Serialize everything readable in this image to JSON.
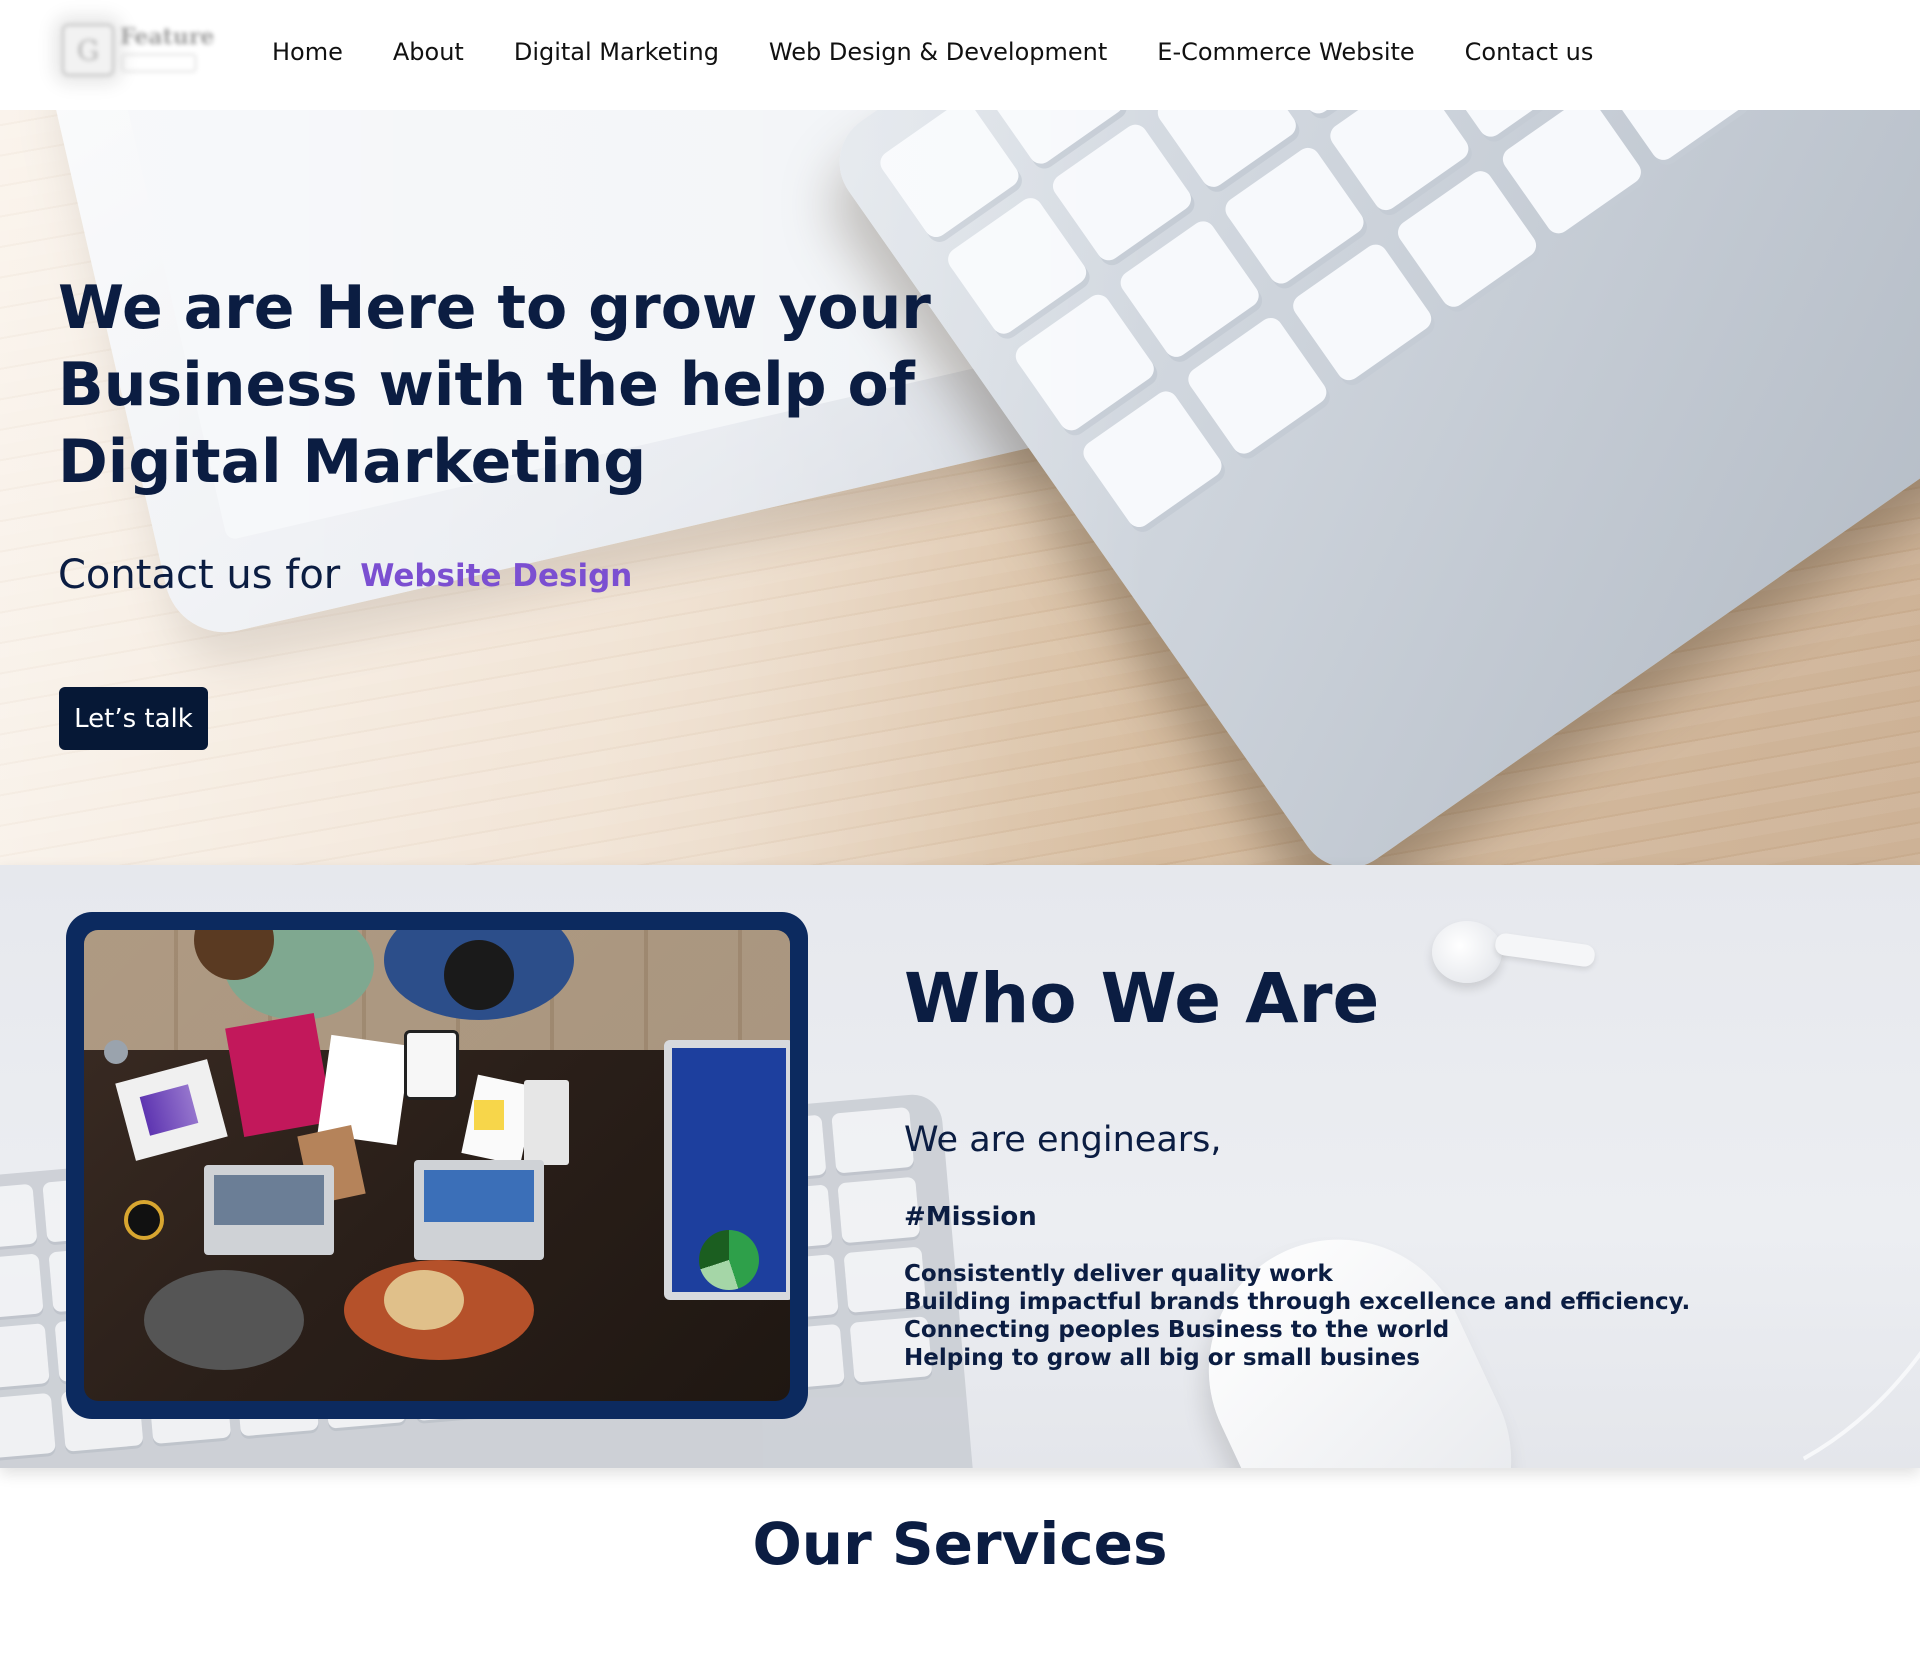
{
  "brand": {
    "logo_text": "Feature"
  },
  "nav": {
    "items": [
      {
        "label": "Home"
      },
      {
        "label": "About"
      },
      {
        "label": "Digital Marketing"
      },
      {
        "label": "Web Design & Development"
      },
      {
        "label": "E-Commerce Website"
      },
      {
        "label": "Contact us"
      }
    ]
  },
  "hero": {
    "title": "We are Here to grow your Business with the help of Digital Marketing",
    "contact_prefix": "Contact us for",
    "contact_highlight": "Website Design",
    "cta_label": "Let’s talk"
  },
  "about": {
    "title": "Who We Are",
    "subtitle": "We are enginears,",
    "mission_heading": "#Mission",
    "mission_items": [
      "Consistently deliver quality work",
      "Building impactful brands through excellence and efficiency.",
      "Connecting peoples Business to the world",
      "Helping to grow all big or small busines"
    ]
  },
  "services": {
    "title": "Our Services"
  },
  "colors": {
    "primary": "#0b1d42",
    "cta_background": "#061836",
    "accent": "#7b4fd1",
    "frame": "#0c2a5f"
  },
  "icons": {
    "logo": "logo-icon"
  }
}
